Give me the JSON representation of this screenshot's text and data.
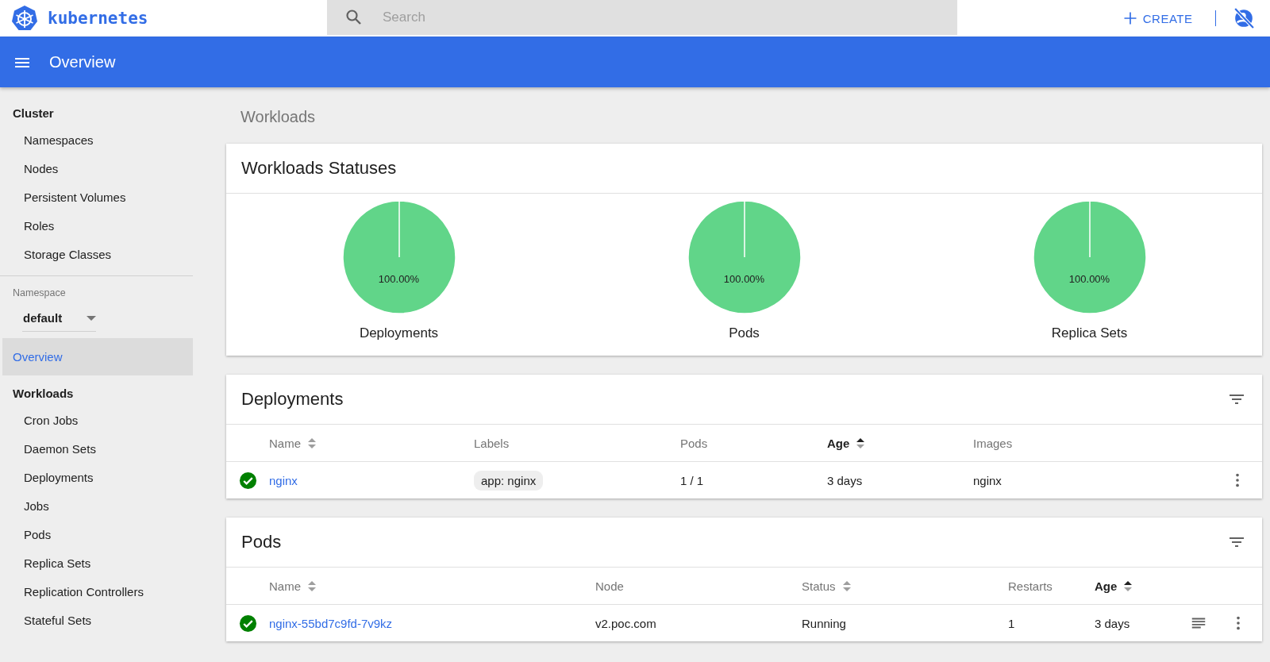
{
  "header": {
    "logo_text": "kubernetes",
    "search": {
      "placeholder": "Search"
    },
    "create_button": "CREATE"
  },
  "toolbar": {
    "title": "Overview"
  },
  "sidebar": {
    "sections": [
      {
        "kind": "group",
        "title": "Cluster",
        "items": [
          {
            "label": "Namespaces",
            "selected": false
          },
          {
            "label": "Nodes",
            "selected": false
          },
          {
            "label": "Persistent Volumes",
            "selected": false
          },
          {
            "label": "Roles",
            "selected": false
          },
          {
            "label": "Storage Classes",
            "selected": false
          }
        ]
      },
      {
        "kind": "select",
        "label": "Namespace",
        "value": "default"
      },
      {
        "kind": "link",
        "label": "Overview",
        "selected": true
      },
      {
        "kind": "group",
        "title": "Workloads",
        "items": [
          {
            "label": "Cron Jobs",
            "selected": false
          },
          {
            "label": "Daemon Sets",
            "selected": false
          },
          {
            "label": "Deployments",
            "selected": false
          },
          {
            "label": "Jobs",
            "selected": false
          },
          {
            "label": "Pods",
            "selected": false
          },
          {
            "label": "Replica Sets",
            "selected": false
          },
          {
            "label": "Replication Controllers",
            "selected": false
          },
          {
            "label": "Stateful Sets",
            "selected": false
          }
        ]
      }
    ]
  },
  "page_title": "Workloads",
  "statuses": {
    "title": "Workloads Statuses",
    "charts": [
      {
        "label": "Deployments",
        "chart_data": {
          "type": "pie",
          "series": [
            {
              "color": "#61d589",
              "values": [
                100
              ]
            }
          ],
          "value_labels": [
            "100.00%"
          ]
        }
      },
      {
        "label": "Pods",
        "chart_data": {
          "type": "pie",
          "series": [
            {
              "color": "#61d589",
              "values": [
                100
              ]
            }
          ],
          "value_labels": [
            "100.00%"
          ]
        }
      },
      {
        "label": "Replica Sets",
        "chart_data": {
          "type": "pie",
          "series": [
            {
              "color": "#61d589",
              "values": [
                100
              ]
            }
          ],
          "value_labels": [
            "100.00%"
          ]
        }
      }
    ]
  },
  "tables": [
    {
      "kind": "deployments",
      "title": "Deployments",
      "columns": [
        {
          "label": "Name",
          "sortable": true,
          "sorted": false
        },
        {
          "label": "Labels",
          "sortable": false,
          "sorted": false
        },
        {
          "label": "Pods",
          "sortable": false,
          "sorted": false
        },
        {
          "label": "Age",
          "sortable": true,
          "sorted": true
        },
        {
          "label": "Images",
          "sortable": false,
          "sorted": false
        }
      ],
      "rows": [
        {
          "healthy": true,
          "cells": [
            {
              "kind": "link",
              "text": "nginx"
            },
            {
              "kind": "chips",
              "items": [
                "app: nginx"
              ]
            },
            {
              "kind": "text",
              "text": "1 / 1"
            },
            {
              "kind": "text",
              "text": "3 days"
            },
            {
              "kind": "text",
              "text": "nginx"
            }
          ],
          "actions": [
            {
              "kind": "menu"
            }
          ]
        }
      ]
    },
    {
      "kind": "pods",
      "title": "Pods",
      "columns": [
        {
          "label": "Name",
          "sortable": true,
          "sorted": false
        },
        {
          "label": "Node",
          "sortable": false,
          "sorted": false
        },
        {
          "label": "Status",
          "sortable": true,
          "sorted": false
        },
        {
          "label": "Restarts",
          "sortable": false,
          "sorted": false
        },
        {
          "label": "Age",
          "sortable": true,
          "sorted": true
        }
      ],
      "rows": [
        {
          "healthy": true,
          "cells": [
            {
              "kind": "link",
              "text": "nginx-55bd7c9fd-7v9kz"
            },
            {
              "kind": "text",
              "text": "v2.poc.com"
            },
            {
              "kind": "text",
              "text": "Running"
            },
            {
              "kind": "text",
              "text": "1"
            },
            {
              "kind": "text",
              "text": "3 days"
            }
          ],
          "actions": [
            {
              "kind": "logs"
            },
            {
              "kind": "menu"
            }
          ]
        }
      ]
    }
  ]
}
